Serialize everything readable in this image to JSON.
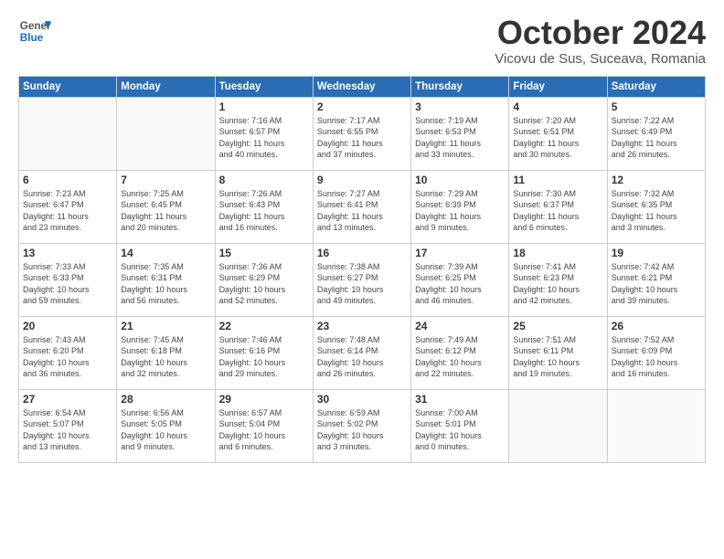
{
  "header": {
    "logo_line1": "General",
    "logo_line2": "Blue",
    "month_title": "October 2024",
    "subtitle": "Vicovu de Sus, Suceava, Romania"
  },
  "weekdays": [
    "Sunday",
    "Monday",
    "Tuesday",
    "Wednesday",
    "Thursday",
    "Friday",
    "Saturday"
  ],
  "weeks": [
    [
      {
        "day": "",
        "detail": ""
      },
      {
        "day": "",
        "detail": ""
      },
      {
        "day": "1",
        "detail": "Sunrise: 7:16 AM\nSunset: 6:57 PM\nDaylight: 11 hours\nand 40 minutes."
      },
      {
        "day": "2",
        "detail": "Sunrise: 7:17 AM\nSunset: 6:55 PM\nDaylight: 11 hours\nand 37 minutes."
      },
      {
        "day": "3",
        "detail": "Sunrise: 7:19 AM\nSunset: 6:53 PM\nDaylight: 11 hours\nand 33 minutes."
      },
      {
        "day": "4",
        "detail": "Sunrise: 7:20 AM\nSunset: 6:51 PM\nDaylight: 11 hours\nand 30 minutes."
      },
      {
        "day": "5",
        "detail": "Sunrise: 7:22 AM\nSunset: 6:49 PM\nDaylight: 11 hours\nand 26 minutes."
      }
    ],
    [
      {
        "day": "6",
        "detail": "Sunrise: 7:23 AM\nSunset: 6:47 PM\nDaylight: 11 hours\nand 23 minutes."
      },
      {
        "day": "7",
        "detail": "Sunrise: 7:25 AM\nSunset: 6:45 PM\nDaylight: 11 hours\nand 20 minutes."
      },
      {
        "day": "8",
        "detail": "Sunrise: 7:26 AM\nSunset: 6:43 PM\nDaylight: 11 hours\nand 16 minutes."
      },
      {
        "day": "9",
        "detail": "Sunrise: 7:27 AM\nSunset: 6:41 PM\nDaylight: 11 hours\nand 13 minutes."
      },
      {
        "day": "10",
        "detail": "Sunrise: 7:29 AM\nSunset: 6:39 PM\nDaylight: 11 hours\nand 9 minutes."
      },
      {
        "day": "11",
        "detail": "Sunrise: 7:30 AM\nSunset: 6:37 PM\nDaylight: 11 hours\nand 6 minutes."
      },
      {
        "day": "12",
        "detail": "Sunrise: 7:32 AM\nSunset: 6:35 PM\nDaylight: 11 hours\nand 3 minutes."
      }
    ],
    [
      {
        "day": "13",
        "detail": "Sunrise: 7:33 AM\nSunset: 6:33 PM\nDaylight: 10 hours\nand 59 minutes."
      },
      {
        "day": "14",
        "detail": "Sunrise: 7:35 AM\nSunset: 6:31 PM\nDaylight: 10 hours\nand 56 minutes."
      },
      {
        "day": "15",
        "detail": "Sunrise: 7:36 AM\nSunset: 6:29 PM\nDaylight: 10 hours\nand 52 minutes."
      },
      {
        "day": "16",
        "detail": "Sunrise: 7:38 AM\nSunset: 6:27 PM\nDaylight: 10 hours\nand 49 minutes."
      },
      {
        "day": "17",
        "detail": "Sunrise: 7:39 AM\nSunset: 6:25 PM\nDaylight: 10 hours\nand 46 minutes."
      },
      {
        "day": "18",
        "detail": "Sunrise: 7:41 AM\nSunset: 6:23 PM\nDaylight: 10 hours\nand 42 minutes."
      },
      {
        "day": "19",
        "detail": "Sunrise: 7:42 AM\nSunset: 6:21 PM\nDaylight: 10 hours\nand 39 minutes."
      }
    ],
    [
      {
        "day": "20",
        "detail": "Sunrise: 7:43 AM\nSunset: 6:20 PM\nDaylight: 10 hours\nand 36 minutes."
      },
      {
        "day": "21",
        "detail": "Sunrise: 7:45 AM\nSunset: 6:18 PM\nDaylight: 10 hours\nand 32 minutes."
      },
      {
        "day": "22",
        "detail": "Sunrise: 7:46 AM\nSunset: 6:16 PM\nDaylight: 10 hours\nand 29 minutes."
      },
      {
        "day": "23",
        "detail": "Sunrise: 7:48 AM\nSunset: 6:14 PM\nDaylight: 10 hours\nand 26 minutes."
      },
      {
        "day": "24",
        "detail": "Sunrise: 7:49 AM\nSunset: 6:12 PM\nDaylight: 10 hours\nand 22 minutes."
      },
      {
        "day": "25",
        "detail": "Sunrise: 7:51 AM\nSunset: 6:11 PM\nDaylight: 10 hours\nand 19 minutes."
      },
      {
        "day": "26",
        "detail": "Sunrise: 7:52 AM\nSunset: 6:09 PM\nDaylight: 10 hours\nand 16 minutes."
      }
    ],
    [
      {
        "day": "27",
        "detail": "Sunrise: 6:54 AM\nSunset: 5:07 PM\nDaylight: 10 hours\nand 13 minutes."
      },
      {
        "day": "28",
        "detail": "Sunrise: 6:56 AM\nSunset: 5:05 PM\nDaylight: 10 hours\nand 9 minutes."
      },
      {
        "day": "29",
        "detail": "Sunrise: 6:57 AM\nSunset: 5:04 PM\nDaylight: 10 hours\nand 6 minutes."
      },
      {
        "day": "30",
        "detail": "Sunrise: 6:59 AM\nSunset: 5:02 PM\nDaylight: 10 hours\nand 3 minutes."
      },
      {
        "day": "31",
        "detail": "Sunrise: 7:00 AM\nSunset: 5:01 PM\nDaylight: 10 hours\nand 0 minutes."
      },
      {
        "day": "",
        "detail": ""
      },
      {
        "day": "",
        "detail": ""
      }
    ]
  ]
}
